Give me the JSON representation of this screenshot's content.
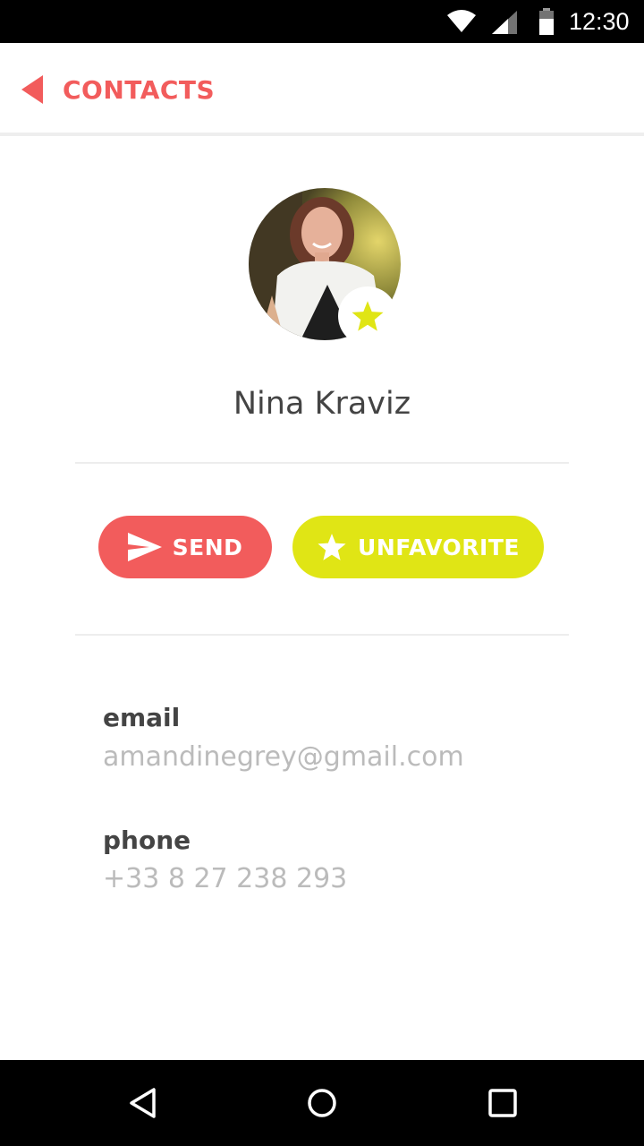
{
  "status_bar": {
    "time": "12:30",
    "icons": [
      "wifi-icon",
      "signal-icon",
      "battery-icon"
    ]
  },
  "header": {
    "back_label": "CONTACTS",
    "back_icon": "back-arrow-icon"
  },
  "contact": {
    "name": "Nina Kraviz",
    "is_favorite": true,
    "avatar_icon": "avatar-photo",
    "badge_icon": "star-icon"
  },
  "actions": {
    "send_label": "SEND",
    "send_icon": "send-icon",
    "unfavorite_label": "UNFAVORITE",
    "unfavorite_icon": "star-icon"
  },
  "details": {
    "email_label": "email",
    "email_value": "amandinegrey@gmail.com",
    "phone_label": "phone",
    "phone_value": "+33 8 27 238 293"
  },
  "nav_bar": {
    "icons": [
      "nav-back-icon",
      "nav-home-icon",
      "nav-recents-icon"
    ]
  },
  "colors": {
    "accent": "#f25c5c",
    "favorite": "#e0e515",
    "text_primary": "#444444",
    "text_secondary": "#bbbbbb",
    "divider": "#ededed"
  }
}
